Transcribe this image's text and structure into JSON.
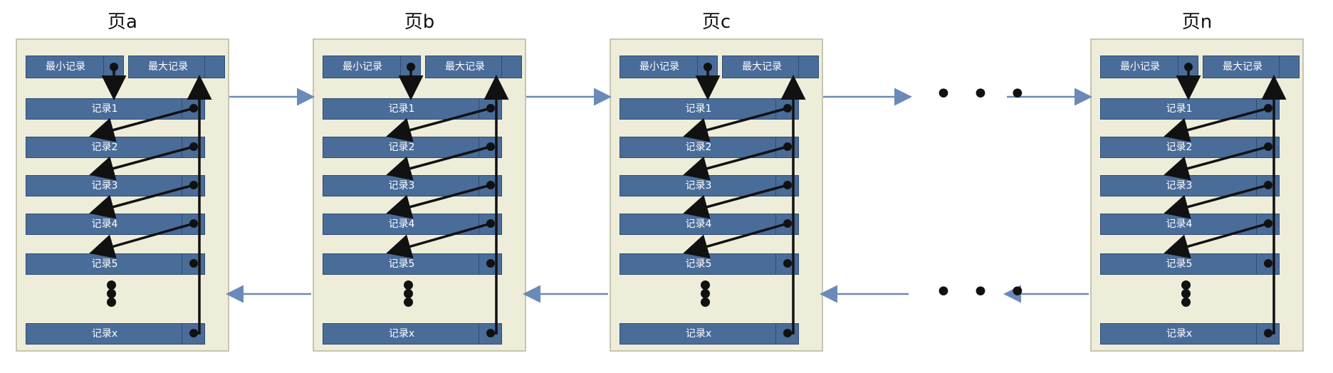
{
  "pages": [
    {
      "title": "页a"
    },
    {
      "title": "页b"
    },
    {
      "title": "页c"
    },
    {
      "title": "页n"
    }
  ],
  "header": {
    "min_label": "最小记录",
    "max_label": "最大记录"
  },
  "records": [
    "记录1",
    "记录2",
    "记录3",
    "记录4",
    "记录5"
  ],
  "last_record": "记录x",
  "ellipsis_between_pages": "• • •",
  "colors": {
    "record_fill": "#4a6c99",
    "page_bg": "#ededd9",
    "link_arrow": "#6a8ab8",
    "pointer_arrow": "#111111"
  }
}
